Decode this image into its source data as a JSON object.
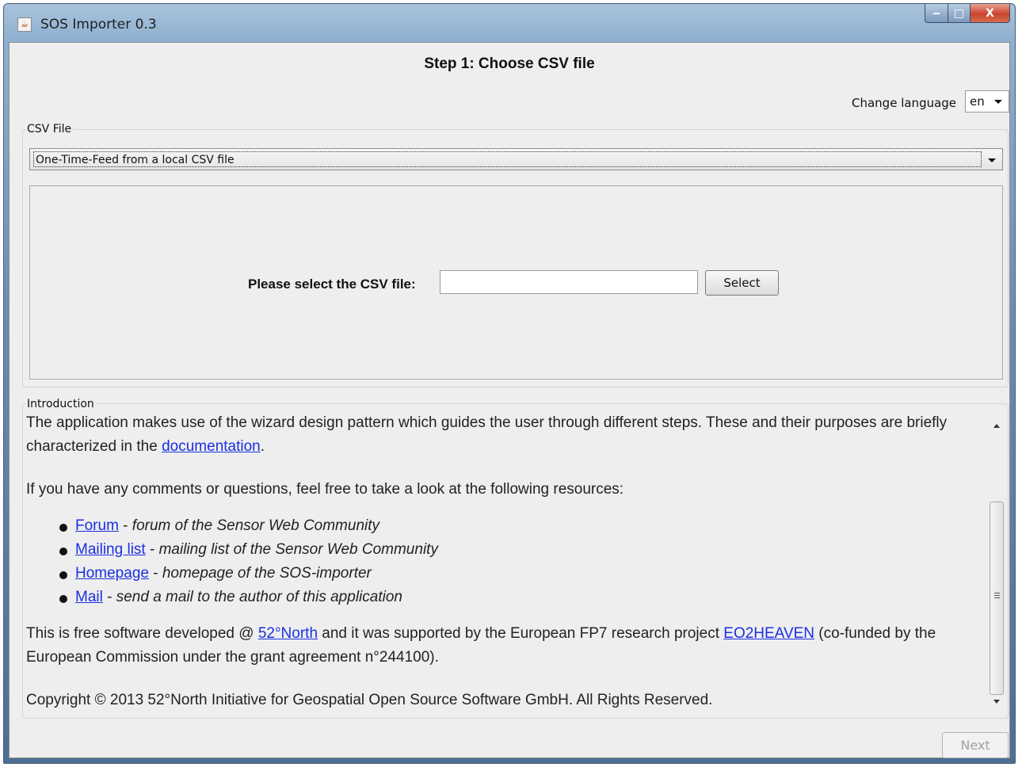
{
  "window": {
    "title": "SOS Importer 0.3",
    "controls": {
      "minimize": "‒",
      "maximize": "□",
      "close": "X"
    }
  },
  "header": {
    "step_title": "Step 1: Choose CSV file",
    "language_label": "Change language",
    "language_value": "en"
  },
  "csv_file": {
    "group_label": "CSV File",
    "source_option": "One-Time-Feed from a local CSV file",
    "select_label": "Please select the CSV file:",
    "file_path": "",
    "select_button": "Select"
  },
  "introduction": {
    "group_label": "Introduction",
    "para1_text": "The application makes use of the wizard design pattern which guides the user through different steps. These and their purposes are briefly characterized in the ",
    "para1_link": "documentation",
    "para1_end": ".",
    "para2": "If you have any comments or questions, feel free to take a look at the following resources:",
    "resources": [
      {
        "link": "Forum",
        "sep": " - ",
        "desc": "forum of the Sensor Web Community"
      },
      {
        "link": "Mailing list",
        "sep": " - ",
        "desc": "mailing list of the Sensor Web Community"
      },
      {
        "link": "Homepage",
        "sep": " - ",
        "desc": "homepage of the SOS-importer"
      },
      {
        "link": "Mail",
        "sep": " - ",
        "desc": "send a mail to the author of this application"
      }
    ],
    "para3_a": "This is free software developed @ ",
    "para3_link1": "52°North",
    "para3_b": " and it was supported by the European FP7 research project ",
    "para3_link2": "EO2HEAVEN",
    "para3_c": " (co-funded by the European Commission under the grant agreement n°244100).",
    "copyright": "Copyright © 2013 52°North Initiative for Geospatial Open Source Software GmbH. All Rights Reserved."
  },
  "footer": {
    "next_button": "Next"
  }
}
